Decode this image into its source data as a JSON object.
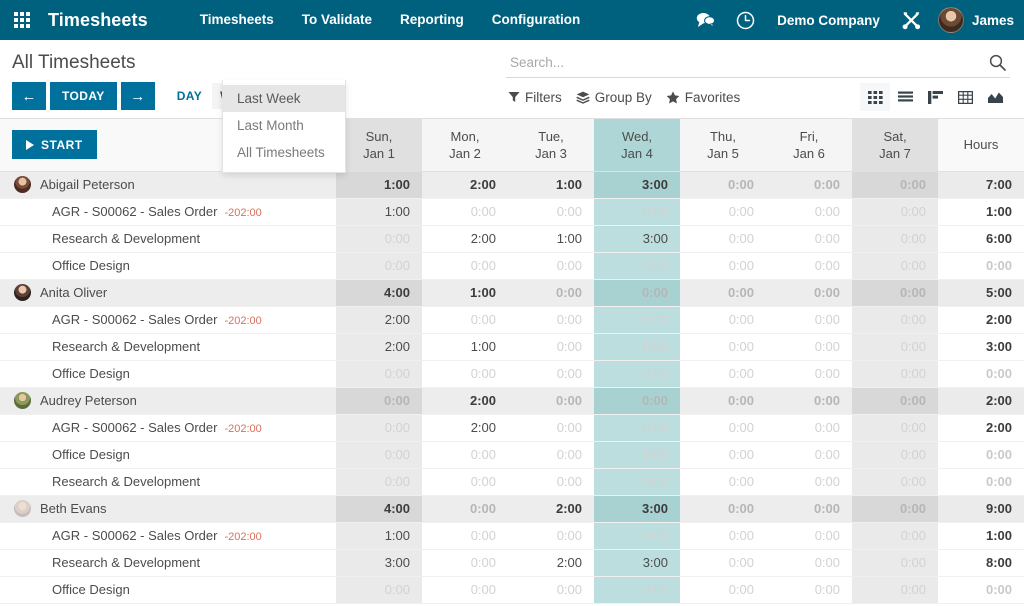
{
  "navbar": {
    "apps_icon": "apps-grid-icon",
    "brand": "Timesheets",
    "menu": [
      {
        "label": "Timesheets"
      },
      {
        "label": "To Validate"
      },
      {
        "label": "Reporting"
      },
      {
        "label": "Configuration"
      }
    ],
    "messages_icon": "chat-bubble-icon",
    "activity_icon": "clock-icon",
    "company": "Demo Company",
    "settings_icon": "tools-icon",
    "user": "James",
    "accent_color": "#00617f"
  },
  "dropdown": {
    "items": [
      {
        "label": "Last Week",
        "hovered": true
      },
      {
        "label": "Last Month",
        "hovered": false
      },
      {
        "label": "All Timesheets",
        "hovered": false
      }
    ]
  },
  "control_panel": {
    "title": "All Timesheets",
    "prev_label": "←",
    "today_label": "TODAY",
    "next_label": "→",
    "scales": [
      {
        "label": "DAY",
        "active": false
      },
      {
        "label": "WEEK",
        "active": true
      }
    ],
    "search": {
      "value": "",
      "placeholder": "Search..."
    },
    "filters_label": "Filters",
    "group_by_label": "Group By",
    "favorites_label": "Favorites",
    "views": [
      {
        "name": "kanban-view-icon",
        "active": true
      },
      {
        "name": "list-view-icon",
        "active": false
      },
      {
        "name": "gantt-view-icon",
        "active": false
      },
      {
        "name": "pivot-view-icon",
        "active": false
      },
      {
        "name": "graph-view-icon",
        "active": false
      }
    ]
  },
  "grid": {
    "start_label": "START",
    "hours_label": "Hours",
    "budget_label": "-202:00",
    "columns": [
      {
        "day": "Sun,",
        "date": "Jan 1",
        "type": "weekend"
      },
      {
        "day": "Mon,",
        "date": "Jan 2",
        "type": "plain"
      },
      {
        "day": "Tue,",
        "date": "Jan 3",
        "type": "plain"
      },
      {
        "day": "Wed,",
        "date": "Jan 4",
        "type": "today"
      },
      {
        "day": "Thu,",
        "date": "Jan 5",
        "type": "plain"
      },
      {
        "day": "Fri,",
        "date": "Jan 6",
        "type": "plain"
      },
      {
        "day": "Sat,",
        "date": "Jan 7",
        "type": "weekend"
      }
    ],
    "rows": [
      {
        "kind": "employee",
        "avatar": "av-1",
        "label": "Abigail Peterson",
        "values": [
          "1:00",
          "2:00",
          "1:00",
          "3:00",
          "0:00",
          "0:00",
          "0:00"
        ],
        "total": "7:00"
      },
      {
        "kind": "task",
        "label": "AGR - S00062 - Sales Order",
        "budget": "-202:00",
        "values": [
          "1:00",
          "0:00",
          "0:00",
          "0:00",
          "0:00",
          "0:00",
          "0:00"
        ],
        "total": "1:00"
      },
      {
        "kind": "task",
        "label": "Research & Development",
        "budget": "",
        "values": [
          "0:00",
          "2:00",
          "1:00",
          "3:00",
          "0:00",
          "0:00",
          "0:00"
        ],
        "total": "6:00"
      },
      {
        "kind": "task",
        "label": "Office Design",
        "budget": "",
        "values": [
          "0:00",
          "0:00",
          "0:00",
          "0:00",
          "0:00",
          "0:00",
          "0:00"
        ],
        "total": "0:00"
      },
      {
        "kind": "employee",
        "avatar": "av-2",
        "label": "Anita Oliver",
        "values": [
          "4:00",
          "1:00",
          "0:00",
          "0:00",
          "0:00",
          "0:00",
          "0:00"
        ],
        "total": "5:00"
      },
      {
        "kind": "task",
        "label": "AGR - S00062 - Sales Order",
        "budget": "-202:00",
        "values": [
          "2:00",
          "0:00",
          "0:00",
          "0:00",
          "0:00",
          "0:00",
          "0:00"
        ],
        "total": "2:00"
      },
      {
        "kind": "task",
        "label": "Research & Development",
        "budget": "",
        "values": [
          "2:00",
          "1:00",
          "0:00",
          "0:00",
          "0:00",
          "0:00",
          "0:00"
        ],
        "total": "3:00"
      },
      {
        "kind": "task",
        "label": "Office Design",
        "budget": "",
        "values": [
          "0:00",
          "0:00",
          "0:00",
          "0:00",
          "0:00",
          "0:00",
          "0:00"
        ],
        "total": "0:00"
      },
      {
        "kind": "employee",
        "avatar": "av-3",
        "label": "Audrey Peterson",
        "values": [
          "0:00",
          "2:00",
          "0:00",
          "0:00",
          "0:00",
          "0:00",
          "0:00"
        ],
        "total": "2:00"
      },
      {
        "kind": "task",
        "label": "AGR - S00062 - Sales Order",
        "budget": "-202:00",
        "values": [
          "0:00",
          "2:00",
          "0:00",
          "0:00",
          "0:00",
          "0:00",
          "0:00"
        ],
        "total": "2:00"
      },
      {
        "kind": "task",
        "label": "Office Design",
        "budget": "",
        "values": [
          "0:00",
          "0:00",
          "0:00",
          "0:00",
          "0:00",
          "0:00",
          "0:00"
        ],
        "total": "0:00"
      },
      {
        "kind": "task",
        "label": "Research & Development",
        "budget": "",
        "values": [
          "0:00",
          "0:00",
          "0:00",
          "0:00",
          "0:00",
          "0:00",
          "0:00"
        ],
        "total": "0:00"
      },
      {
        "kind": "employee",
        "avatar": "av-4",
        "label": "Beth Evans",
        "values": [
          "4:00",
          "0:00",
          "2:00",
          "3:00",
          "0:00",
          "0:00",
          "0:00"
        ],
        "total": "9:00"
      },
      {
        "kind": "task",
        "label": "AGR - S00062 - Sales Order",
        "budget": "-202:00",
        "values": [
          "1:00",
          "0:00",
          "0:00",
          "0:00",
          "0:00",
          "0:00",
          "0:00"
        ],
        "total": "1:00"
      },
      {
        "kind": "task",
        "label": "Research & Development",
        "budget": "",
        "values": [
          "3:00",
          "0:00",
          "2:00",
          "3:00",
          "0:00",
          "0:00",
          "0:00"
        ],
        "total": "8:00"
      },
      {
        "kind": "task",
        "label": "Office Design",
        "budget": "",
        "values": [
          "0:00",
          "0:00",
          "0:00",
          "0:00",
          "0:00",
          "0:00",
          "0:00"
        ],
        "total": "0:00"
      }
    ]
  }
}
